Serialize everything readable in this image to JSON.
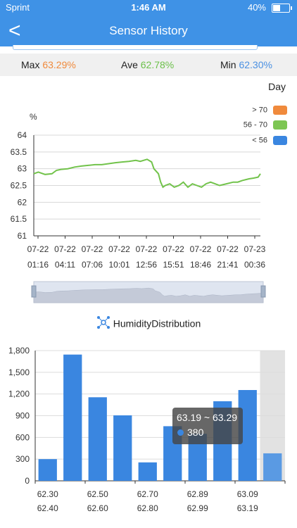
{
  "status_bar": {
    "carrier": "Sprint",
    "time": "1:46 AM",
    "battery": "40%"
  },
  "header": {
    "back_label": "<",
    "title": "Sensor History"
  },
  "stats": {
    "max_label": "Max",
    "max_value": "63.29%",
    "ave_label": "Ave",
    "ave_value": "62.78%",
    "min_label": "Min",
    "min_value": "62.30%"
  },
  "colors": {
    "max": "#f08a3c",
    "ave": "#6cc04a",
    "min": "#4a90e2",
    "accent": "#3f92e6",
    "line": "#72c34b",
    "bar": "#3a86e0"
  },
  "range_button": "Day",
  "legend": [
    {
      "label": "> 70",
      "color": "#f08a3c"
    },
    {
      "label": "56 - 70",
      "color": "#7dc653"
    },
    {
      "label": "< 56",
      "color": "#3a86e0"
    }
  ],
  "dist_title": "HumidityDistribution",
  "tooltip": {
    "range": "63.19 ~ 63.29",
    "value": "380"
  },
  "chart_data": [
    {
      "type": "line",
      "ylabel": "%",
      "ylim": [
        61,
        64
      ],
      "yticks": [
        "64",
        "63.5",
        "63",
        "62.5",
        "62",
        "61.5",
        "61"
      ],
      "xtick_dates": [
        "07-22",
        "07-22",
        "07-22",
        "07-22",
        "07-22",
        "07-22",
        "07-22",
        "07-22",
        "07-23"
      ],
      "xtick_times": [
        "01:16",
        "04:11",
        "07:06",
        "10:01",
        "12:56",
        "15:51",
        "18:46",
        "21:41",
        "00:36"
      ],
      "series": [
        {
          "x": [
            0,
            0.02,
            0.05,
            0.08,
            0.1,
            0.12,
            0.15,
            0.18,
            0.21,
            0.24,
            0.27,
            0.3,
            0.33,
            0.36,
            0.39,
            0.42,
            0.45,
            0.47,
            0.5,
            0.52,
            0.53,
            0.55,
            0.56,
            0.57,
            0.58,
            0.6,
            0.62,
            0.64,
            0.66,
            0.68,
            0.7,
            0.72,
            0.74,
            0.76,
            0.78,
            0.8,
            0.82,
            0.85,
            0.88,
            0.9,
            0.92,
            0.95,
            0.97,
            0.99,
            1.0
          ],
          "values": [
            62.85,
            62.9,
            62.83,
            62.85,
            62.95,
            62.98,
            63.0,
            63.05,
            63.08,
            63.1,
            63.12,
            63.12,
            63.15,
            63.18,
            63.2,
            63.22,
            63.25,
            63.22,
            63.28,
            63.2,
            63.0,
            62.85,
            62.6,
            62.45,
            62.5,
            62.55,
            62.45,
            62.5,
            62.6,
            62.45,
            62.55,
            62.5,
            62.45,
            62.55,
            62.6,
            62.55,
            62.5,
            62.55,
            62.6,
            62.6,
            62.65,
            62.7,
            62.72,
            62.75,
            62.85
          ]
        }
      ]
    },
    {
      "type": "bar",
      "ylim": [
        0,
        1800
      ],
      "yticks": [
        "1,800",
        "1,500",
        "1,200",
        "900",
        "600",
        "300",
        "0"
      ],
      "categories": [
        "62.30",
        "62.40",
        "62.50",
        "62.60",
        "62.70",
        "62.80",
        "62.89",
        "62.99",
        "63.09",
        "63.19"
      ],
      "values": [
        300,
        1745,
        1155,
        905,
        255,
        755,
        650,
        1100,
        1255,
        380
      ],
      "highlighted_index": 9
    }
  ]
}
